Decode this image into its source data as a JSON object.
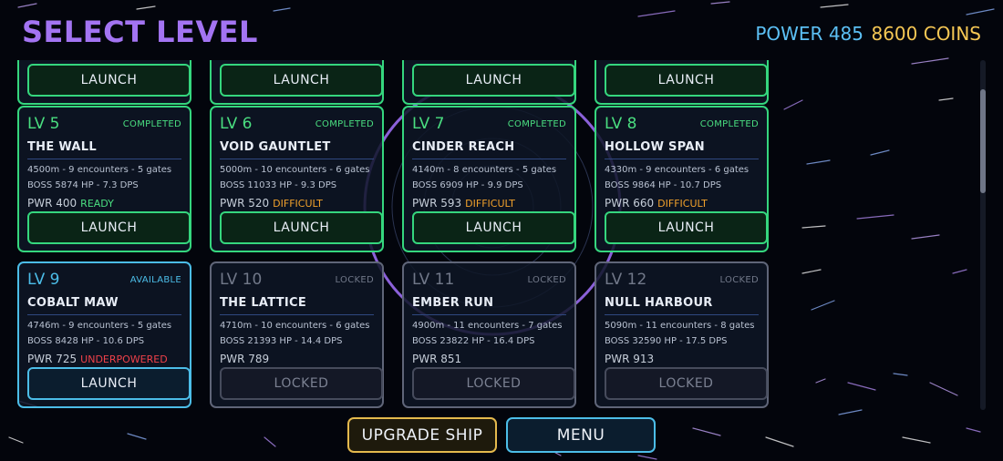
{
  "header": {
    "title": "SELECT LEVEL",
    "power": "POWER 485",
    "coins": "8600 COINS"
  },
  "colors": {
    "completed": "#4ade80",
    "available": "#4cbde8",
    "locked": "#717889",
    "difficult": "#f0a02b",
    "underpowered": "#f0414a",
    "title": "#a374f2",
    "coins": "#f5c754"
  },
  "levels": [
    {
      "level": "",
      "status": "",
      "name": "",
      "stats": "",
      "boss": "",
      "pwr": "",
      "tag": "",
      "button": "LAUNCH",
      "state": "completed"
    },
    {
      "level": "",
      "status": "",
      "name": "",
      "stats": "",
      "boss": "",
      "pwr": "",
      "tag": "",
      "button": "LAUNCH",
      "state": "completed"
    },
    {
      "level": "",
      "status": "",
      "name": "",
      "stats": "",
      "boss": "",
      "pwr": "",
      "tag": "",
      "button": "LAUNCH",
      "state": "completed"
    },
    {
      "level": "",
      "status": "",
      "name": "",
      "stats": "",
      "boss": "",
      "pwr": "",
      "tag": "",
      "button": "LAUNCH",
      "state": "completed"
    },
    {
      "level": "LV 5",
      "status": "COMPLETED",
      "name": "THE WALL",
      "stats": "4500m  -  9 encounters  -  5 gates",
      "boss": "BOSS 5874 HP  -  7.3 DPS",
      "pwr": "PWR 400",
      "tag": "READY",
      "tag_type": "ready",
      "button": "LAUNCH",
      "state": "completed"
    },
    {
      "level": "LV 6",
      "status": "COMPLETED",
      "name": "VOID GAUNTLET",
      "stats": "5000m  -  10 encounters  -  6 gates",
      "boss": "BOSS 11033 HP  -  9.3 DPS",
      "pwr": "PWR 520",
      "tag": "DIFFICULT",
      "tag_type": "difficult",
      "button": "LAUNCH",
      "state": "completed"
    },
    {
      "level": "LV 7",
      "status": "COMPLETED",
      "name": "CINDER REACH",
      "stats": "4140m  -  8 encounters  -  5 gates",
      "boss": "BOSS 6909 HP  -  9.9 DPS",
      "pwr": "PWR 593",
      "tag": "DIFFICULT",
      "tag_type": "difficult",
      "button": "LAUNCH",
      "state": "completed"
    },
    {
      "level": "LV 8",
      "status": "COMPLETED",
      "name": "HOLLOW SPAN",
      "stats": "4330m  -  9 encounters  -  6 gates",
      "boss": "BOSS 9864 HP  -  10.7 DPS",
      "pwr": "PWR 660",
      "tag": "DIFFICULT",
      "tag_type": "difficult",
      "button": "LAUNCH",
      "state": "completed"
    },
    {
      "level": "LV 9",
      "status": "AVAILABLE",
      "name": "COBALT MAW",
      "stats": "4746m  -  9 encounters  -  5 gates",
      "boss": "BOSS 8428 HP  -  10.6 DPS",
      "pwr": "PWR 725",
      "tag": "UNDERPOWERED",
      "tag_type": "under",
      "button": "LAUNCH",
      "state": "avail"
    },
    {
      "level": "LV 10",
      "status": "LOCKED",
      "name": "THE LATTICE",
      "stats": "4710m  -  10 encounters  -  6 gates",
      "boss": "BOSS 21393 HP  -  14.4 DPS",
      "pwr": "PWR 789",
      "tag": "",
      "tag_type": "",
      "button": "LOCKED",
      "state": "locked"
    },
    {
      "level": "LV 11",
      "status": "LOCKED",
      "name": "EMBER RUN",
      "stats": "4900m  -  11 encounters  -  7 gates",
      "boss": "BOSS 23822 HP  -  16.4 DPS",
      "pwr": "PWR 851",
      "tag": "",
      "tag_type": "",
      "button": "LOCKED",
      "state": "locked"
    },
    {
      "level": "LV 12",
      "status": "LOCKED",
      "name": "NULL HARBOUR",
      "stats": "5090m  -  11 encounters  -  8 gates",
      "boss": "BOSS 32590 HP  -  17.5 DPS",
      "pwr": "PWR 913",
      "tag": "",
      "tag_type": "",
      "button": "LOCKED",
      "state": "locked"
    }
  ],
  "footer": {
    "upgrade": "UPGRADE SHIP",
    "menu": "MENU"
  }
}
